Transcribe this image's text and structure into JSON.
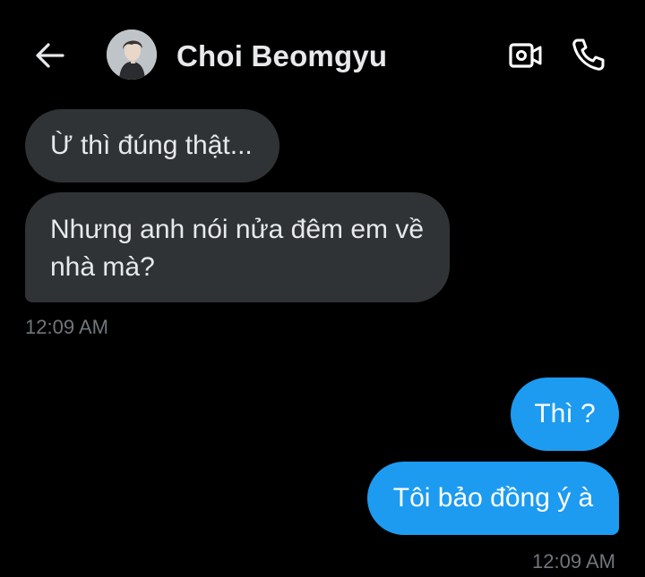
{
  "header": {
    "back_icon": "arrow-left-icon",
    "contact_name": "Choi Beomgyu",
    "video_icon": "video-camera-icon",
    "call_icon": "phone-icon"
  },
  "messages": [
    {
      "direction": "incoming",
      "text": "Ừ thì đúng thật..."
    },
    {
      "direction": "incoming",
      "text": "Nhưng anh nói nửa đêm em về nhà mà?"
    },
    {
      "direction": "outgoing",
      "text": "Thì ?"
    },
    {
      "direction": "outgoing",
      "text": "Tôi bảo đồng ý à"
    }
  ],
  "timestamps": {
    "incoming_group": "12:09 AM",
    "outgoing_group": "12:09 AM"
  },
  "colors": {
    "background": "#000000",
    "incoming_bubble": "#2f3336",
    "outgoing_bubble": "#1d9bf0",
    "timestamp": "#71767b",
    "text": "#e7e9ea"
  }
}
